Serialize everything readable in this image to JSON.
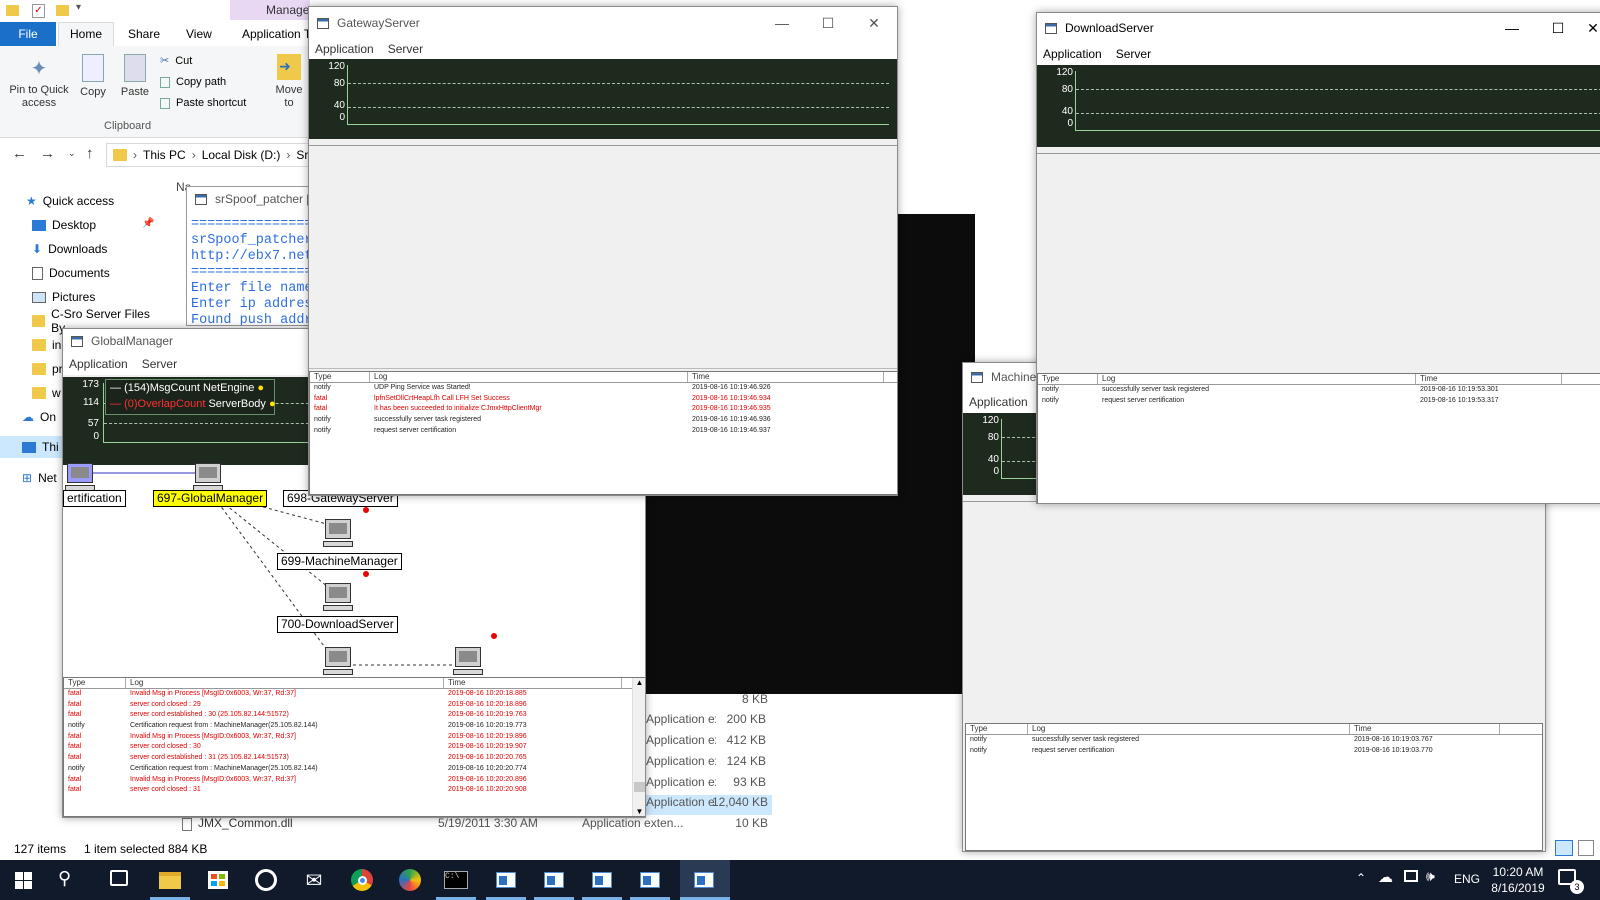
{
  "explorer": {
    "tab_manage": "Manage",
    "tabs": [
      "File",
      "Home",
      "Share",
      "View",
      "Application To"
    ],
    "clipboard": {
      "pin_label": "Pin to Quick access",
      "copy_label": "Copy",
      "paste_label": "Paste",
      "cut_label": "Cut",
      "copy_path_label": "Copy path",
      "paste_shortcut_label": "Paste shortcut",
      "group_label": "Clipboard"
    },
    "move_label": "Move to",
    "breadcrumb": [
      "This PC",
      "Local Disk (D:)",
      "Sr"
    ],
    "column_name": "Na",
    "nav": [
      "Quick access",
      "Desktop",
      "Downloads",
      "Documents",
      "Pictures",
      "C-Sro Server Files By",
      "in",
      "pr",
      "w",
      "On",
      "Thi",
      "Net"
    ],
    "files_partial": [
      {
        "type": "Application exten...",
        "size": "200 KB"
      },
      {
        "type": "Application exten...",
        "size": "412 KB"
      },
      {
        "type": "Application exten...",
        "size": "124 KB"
      },
      {
        "type": "Application exten...",
        "size": "93 KB"
      },
      {
        "type": "Application exten...",
        "size": "12,040 KB"
      }
    ],
    "size_top": "8 KB",
    "last_file": {
      "name": "JMX_Common.dll",
      "date": "5/19/2011 3:30 AM",
      "type": "Application exten...",
      "size": "10 KB"
    },
    "status_items": "127 items",
    "status_selected": "1 item selected  884 KB"
  },
  "spoof": {
    "title": "srSpoof_patcher [I",
    "lines": [
      "================",
      "srSpoof_patcher",
      "http://ebx7.net/",
      "================",
      "Enter file name",
      "Enter ip address",
      "Found push addr"
    ]
  },
  "gateway": {
    "title": "GatewayServer",
    "menu": [
      "Application",
      "Server"
    ],
    "yticks": [
      "120",
      "80",
      "40",
      "0"
    ],
    "log_headers": [
      "Type",
      "Log",
      "Time"
    ],
    "logs": [
      {
        "type": "notify",
        "log": "UDP Ping Service was Started!",
        "time": "2019-08-16 10:19:46.926"
      },
      {
        "type": "fatal",
        "log": "lpfnSetDllCrtHeapLfh Call LFH Set Success",
        "time": "2019-08-16 10:19:46.934"
      },
      {
        "type": "fatal",
        "log": "It has been succeeded to initialize CJmxHttpClientMgr",
        "time": "2019-08-16 10:19:46.935"
      },
      {
        "type": "notify",
        "log": "successfully server task registered",
        "time": "2019-08-16 10:19:46.936"
      },
      {
        "type": "notify",
        "log": "request server certification",
        "time": "2019-08-16 10:19:46.937"
      }
    ]
  },
  "download": {
    "title": "DownloadServer",
    "menu": [
      "Application",
      "Server"
    ],
    "yticks": [
      "120",
      "80",
      "40",
      "0"
    ],
    "log_headers": [
      "Type",
      "Log",
      "Time"
    ],
    "logs": [
      {
        "type": "notify",
        "log": "successfully server task registered",
        "time": "2019-08-16 10:19:53.301"
      },
      {
        "type": "notify",
        "log": "request server certification",
        "time": "2019-08-16 10:19:53.317"
      }
    ]
  },
  "machine": {
    "title": "Machine",
    "menu": [
      "Application"
    ],
    "yticks": [
      "120",
      "80",
      "40",
      "0"
    ],
    "log_headers": [
      "Type",
      "Log",
      "Time"
    ],
    "logs": [
      {
        "type": "notify",
        "log": "successfully server task registered",
        "time": "2019-08-16 10:19:03.767"
      },
      {
        "type": "notify",
        "log": "request server certification",
        "time": "2019-08-16 10:19:03.770"
      }
    ]
  },
  "global": {
    "title": "GlobalManager",
    "menu": [
      "Application",
      "Server"
    ],
    "yticks": [
      "173",
      "114",
      "57",
      "0"
    ],
    "legend": [
      {
        "text": "(154)MsgCount",
        "sub": "NetEngine",
        "color": "#ffffff"
      },
      {
        "text": "(0)OverlapCount",
        "sub": "ServerBody",
        "color": "#ff3030"
      }
    ],
    "nodes": {
      "cert": "ertification",
      "gm": "697-GlobalManager",
      "gw": "698-GatewayServer",
      "mm": "699-MachineManager",
      "ds": "700-DownloadServer"
    },
    "log_headers": [
      "Type",
      "Log",
      "Time"
    ],
    "logs": [
      {
        "type": "fatal",
        "log": "Invalid Msg in Process [MsgID:0x6003, Wr:37, Rd:37]",
        "time": "2019-08-16 10:20:18.885"
      },
      {
        "type": "fatal",
        "log": "server cord closed : 29",
        "time": "2019-08-16 10:20:18.896"
      },
      {
        "type": "fatal",
        "log": "server cord established : 30 (25.105.82.144:51572)",
        "time": "2019-08-16 10:20:19.763"
      },
      {
        "type": "notify",
        "log": "Certification request from : MachineManager(25.105.82.144)",
        "time": "2019-08-16 10:20:19.773"
      },
      {
        "type": "fatal",
        "log": "Invalid Msg in Process [MsgID:0x6003, Wr:37, Rd:37]",
        "time": "2019-08-16 10:20:19.896"
      },
      {
        "type": "fatal",
        "log": "server cord closed : 30",
        "time": "2019-08-16 10:20:19.907"
      },
      {
        "type": "fatal",
        "log": "server cord established : 31 (25.105.82.144:51573)",
        "time": "2019-08-16 10:20:20.765"
      },
      {
        "type": "notify",
        "log": "Certification request from : MachineManager(25.105.82.144)",
        "time": "2019-08-16 10:20:20.774"
      },
      {
        "type": "fatal",
        "log": "Invalid Msg in Process [MsgID:0x6003, Wr:37, Rd:37]",
        "time": "2019-08-16 10:20:20.896"
      },
      {
        "type": "fatal",
        "log": "server cord closed : 31",
        "time": "2019-08-16 10:20:20.908"
      }
    ]
  },
  "taskbar": {
    "lang": "ENG",
    "time": "10:20 AM",
    "date": "8/16/2019",
    "notif_count": "3",
    "apps": [
      "file-explorer-icon",
      "store-icon",
      "obs-icon",
      "mail-icon",
      "chrome-icon",
      "paint-icon",
      "cmd-icon",
      "gateway-app-icon",
      "global-app-icon",
      "machine-app-icon",
      "download-app-icon",
      "active-app-icon"
    ]
  },
  "colors": {
    "accent": "#0078d7",
    "graph_bg": "#1f2a1f",
    "fatal": "#e00000",
    "taskbar": "#101a2a",
    "highlight": "#ffff00"
  }
}
